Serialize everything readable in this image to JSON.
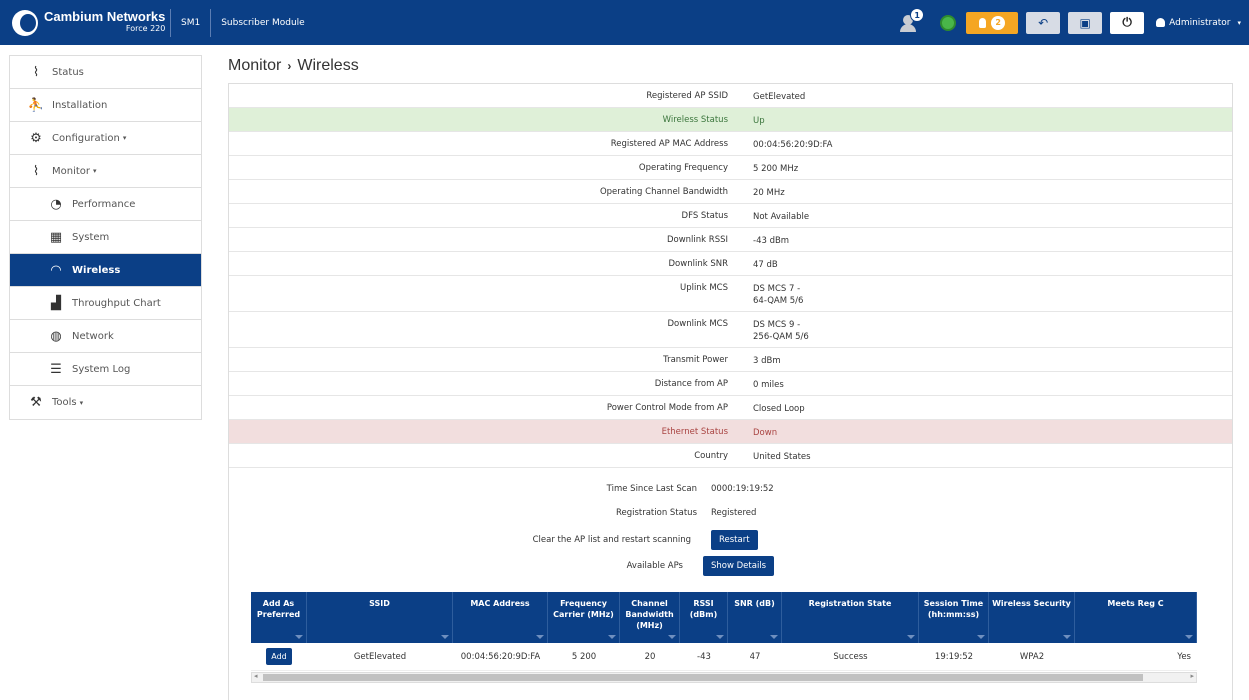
{
  "header": {
    "brand_name": "Cambium Networks",
    "brand_model": "Force 220",
    "device_name": "SM1",
    "device_type": "Subscriber Module",
    "notification_count": "1",
    "alarm_count": "2",
    "user": "Administrator"
  },
  "sidebar": {
    "items": [
      {
        "label": "Status"
      },
      {
        "label": "Installation"
      },
      {
        "label": "Configuration"
      },
      {
        "label": "Monitor"
      },
      {
        "label": "Performance"
      },
      {
        "label": "System"
      },
      {
        "label": "Wireless"
      },
      {
        "label": "Throughput Chart"
      },
      {
        "label": "Network"
      },
      {
        "label": "System Log"
      },
      {
        "label": "Tools"
      }
    ]
  },
  "breadcrumb": {
    "parent": "Monitor",
    "current": "Wireless"
  },
  "wireless": [
    {
      "key": "Registered AP SSID",
      "value": "GetElevated"
    },
    {
      "key": "Wireless Status",
      "value": "Up"
    },
    {
      "key": "Registered AP MAC Address",
      "value": "00:04:56:20:9D:FA"
    },
    {
      "key": "Operating Frequency",
      "value": "5 200 MHz"
    },
    {
      "key": "Operating Channel Bandwidth",
      "value": "20 MHz"
    },
    {
      "key": "DFS Status",
      "value": "Not Available"
    },
    {
      "key": "Downlink RSSI",
      "value": "-43 dBm"
    },
    {
      "key": "Downlink SNR",
      "value": "47 dB"
    },
    {
      "key": "Uplink MCS",
      "value_line1": "DS MCS 7 -",
      "value_line2": "64-QAM 5/6"
    },
    {
      "key": "Downlink MCS",
      "value_line1": "DS MCS 9 -",
      "value_line2": "256-QAM 5/6"
    },
    {
      "key": "Transmit Power",
      "value": "3 dBm"
    },
    {
      "key": "Distance from AP",
      "value": "0 miles"
    },
    {
      "key": "Power Control Mode from AP",
      "value": "Closed Loop"
    },
    {
      "key": "Ethernet Status",
      "value": "Down"
    },
    {
      "key": "Country",
      "value": "United States"
    }
  ],
  "scan": {
    "time_label": "Time Since Last Scan",
    "time_value": "0000:19:19:52",
    "reg_label": "Registration Status",
    "reg_value": "Registered",
    "clear_label": "Clear the AP list and restart scanning",
    "restart_button": "Restart",
    "available_label": "Available APs",
    "show_details_button": "Show Details"
  },
  "ap_table": {
    "headers": [
      "Add As Preferred",
      "SSID",
      "MAC Address",
      "Frequency Carrier (MHz)",
      "Channel Bandwidth (MHz)",
      "RSSI (dBm)",
      "SNR (dB)",
      "Registration State",
      "Session Time (hh:mm:ss)",
      "Wireless Security",
      "Meets Reg C"
    ],
    "rows": [
      {
        "add": "Add",
        "ssid": "GetElevated",
        "mac": "00:04:56:20:9D:FA",
        "freq": "5 200",
        "bw": "20",
        "rssi": "-43",
        "snr": "47",
        "state": "Success",
        "session": "19:19:52",
        "security": "WPA2",
        "meets": "Yes"
      }
    ]
  }
}
